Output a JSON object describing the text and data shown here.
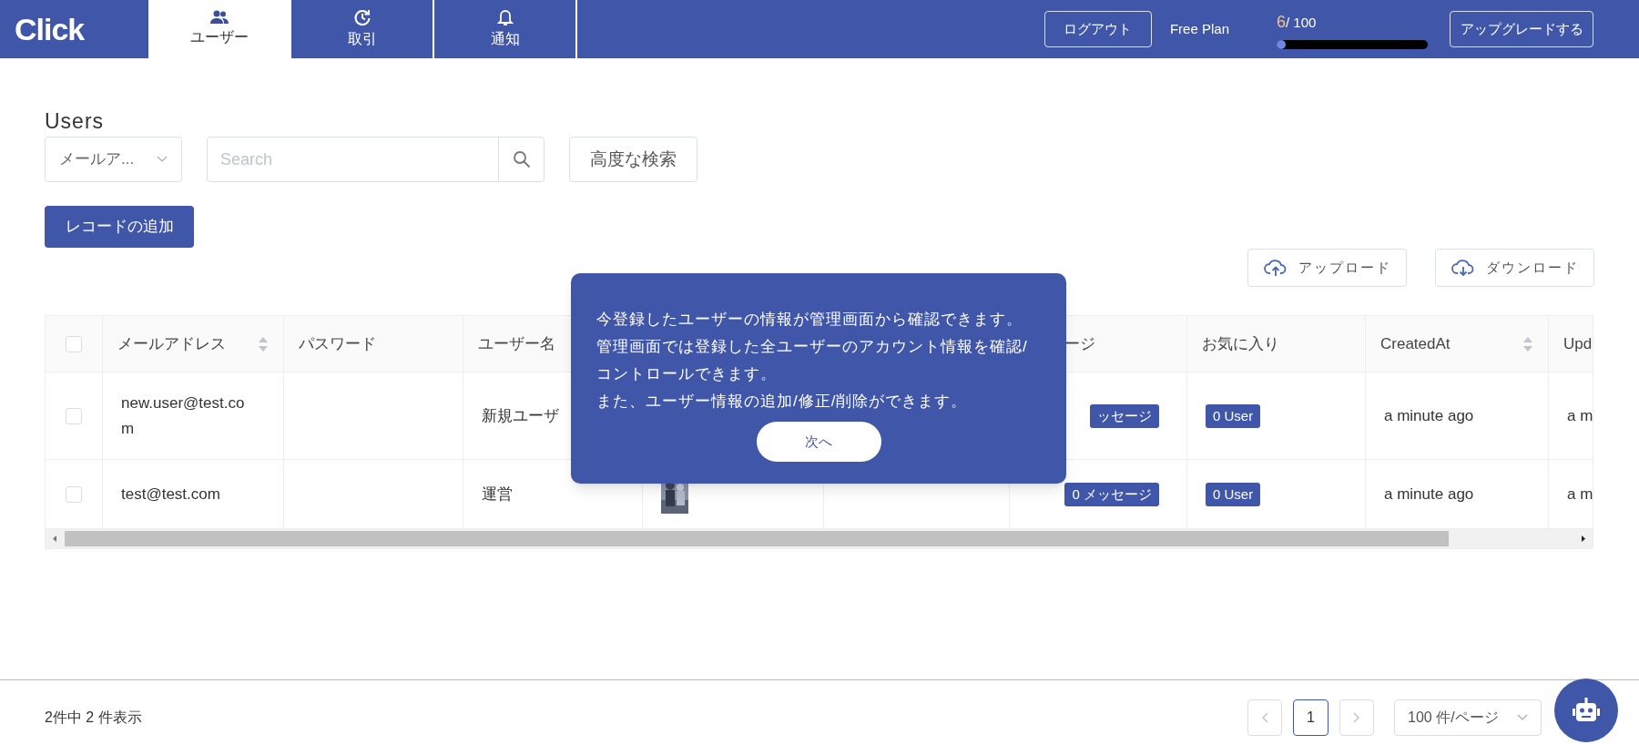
{
  "header": {
    "logo": "Click",
    "tabs": [
      {
        "label": "ユーザー",
        "selected": true
      },
      {
        "label": "取引",
        "selected": false
      },
      {
        "label": "通知",
        "selected": false
      }
    ],
    "logout": "ログアウト",
    "plan": "Free Plan",
    "usage_count": "6",
    "usage_total": "/ 100",
    "usage": {
      "level": 0.02
    },
    "upgrade": "アップグレードする"
  },
  "title": "Users",
  "filter": {
    "field": "メールア...",
    "search_placeholder": "Search",
    "advanced": "高度な検索"
  },
  "add_button": "レコードの追加",
  "upload": "アップロード",
  "download": "ダウンロード",
  "table": {
    "select_all_checked": false,
    "columns": [
      {
        "label": "メールアドレス",
        "sortable": true
      },
      {
        "label": "パスワード",
        "sortable": false
      },
      {
        "label": "ユーザー名"
      },
      {},
      {},
      {
        "label": "ージ",
        "sortable": false
      },
      {
        "label": "お気に入り",
        "sortable": false
      },
      {
        "label": "CreatedAt",
        "sortable": true
      },
      {
        "label": "Upd"
      }
    ],
    "rows": [
      {
        "checked": false,
        "email": "new.user@test.com",
        "username": "新規ユーザ",
        "messages": "ッセージ",
        "favorites": "0 User",
        "created_at": "a minute ago",
        "column_10": "a m"
      },
      {
        "checked": false,
        "email": "test@test.com",
        "username": "運営",
        "messages": "0 メッセージ",
        "favorites": "0 User",
        "created_at": "a minute ago",
        "column_10": "a m"
      }
    ]
  },
  "tour": {
    "lines": [
      "今登録したユーザーの情報が管理画面から確認できます。",
      "管理画面では登録した全ユーザーのアカウント情報を確認/コントロールできます。",
      "また、ユーザー情報の追加/修正/削除ができます。"
    ],
    "next": "次へ"
  },
  "footer": {
    "summary": "2件中 2 件表示",
    "pages": [
      {
        "label": "1",
        "selected": true
      }
    ],
    "page_size": "100 件/ページ"
  }
}
